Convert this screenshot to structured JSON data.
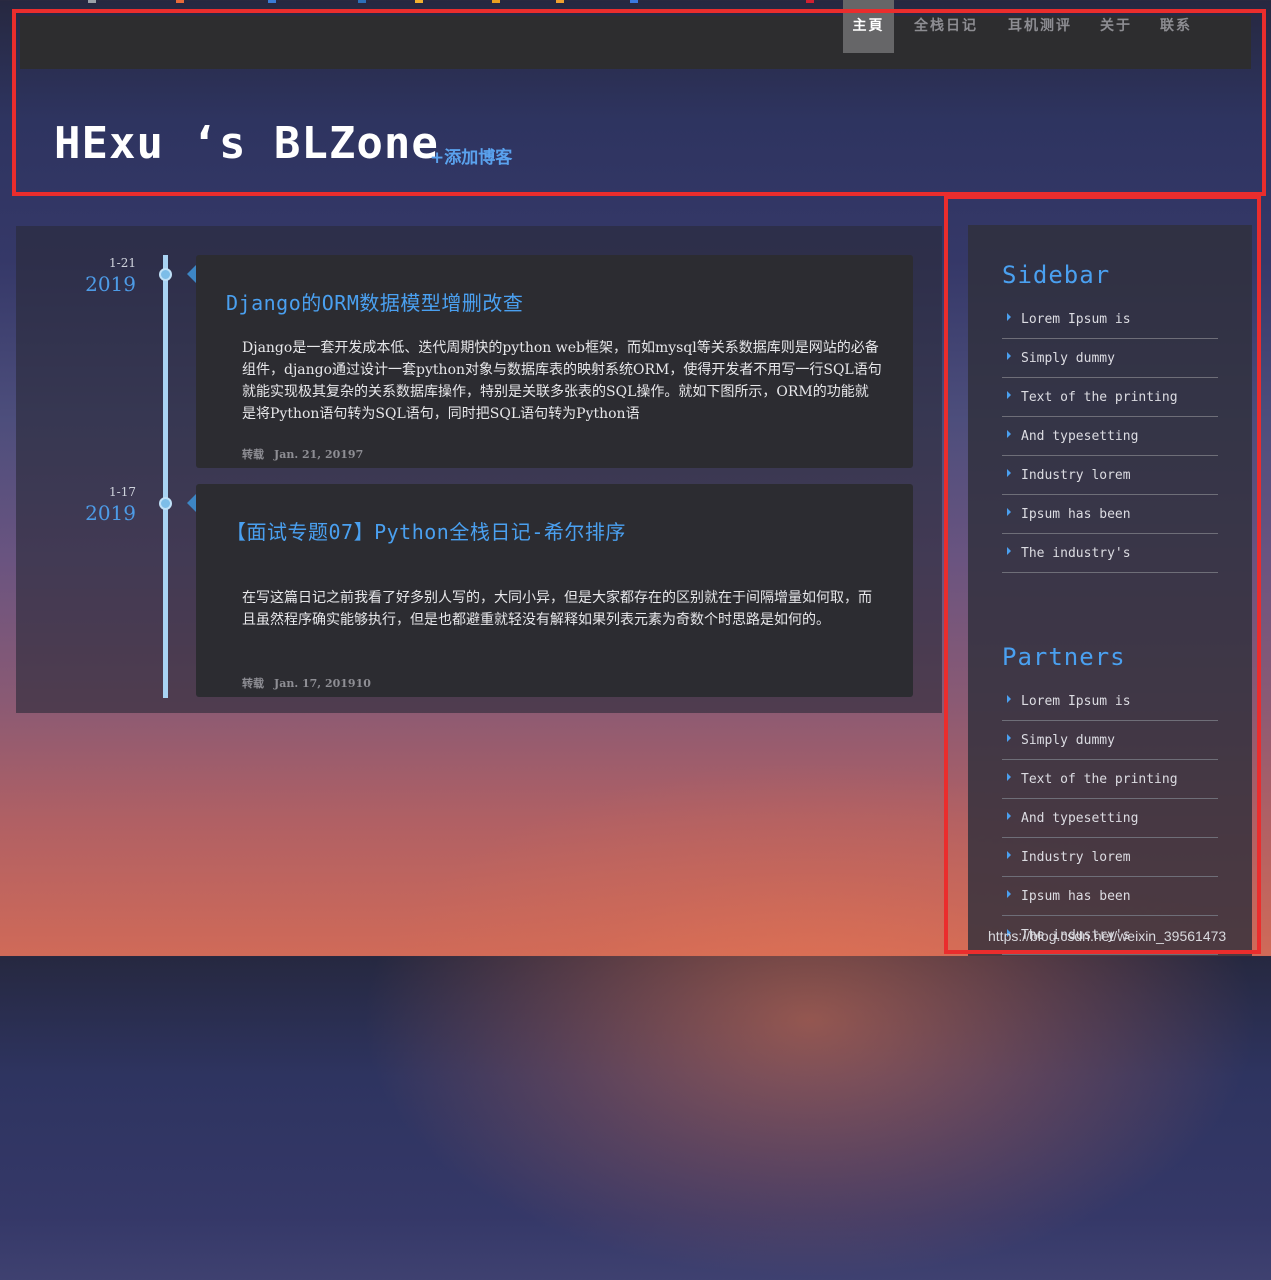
{
  "nav": {
    "items": [
      {
        "label": "主頁",
        "active": true
      },
      {
        "label": "全栈日记",
        "active": false
      },
      {
        "label": "耳机测评",
        "active": false
      },
      {
        "label": "关于",
        "active": false
      },
      {
        "label": "联系",
        "active": false
      }
    ]
  },
  "header": {
    "site_title": "HExu ‘s BLZone",
    "add_blog": "+添加博客"
  },
  "posts": [
    {
      "date_md": "1-21",
      "year": "2019",
      "title": "Django的ORM数据模型增删改查",
      "excerpt": "Django是一套开发成本低、迭代周期快的python web框架，而如mysql等关系数据库则是网站的必备组件，django通过设计一套python对象与数据库表的映射系统ORM，使得开发者不用写一行SQL语句就能实现极其复杂的关系数据库操作，特别是关联多张表的SQL操作。就如下图所示，ORM的功能就是将Python语句转为SQL语句，同时把SQL语句转为Python语",
      "tag": "转载",
      "meta": "Jan. 21, 20197"
    },
    {
      "date_md": "1-17",
      "year": "2019",
      "title": "【面试专题07】Python全栈日记-希尔排序",
      "excerpt": "在写这篇日记之前我看了好多别人写的，大同小异，但是大家都存在的区别就在于间隔增量如何取，而且虽然程序确实能够执行，但是也都避重就轻没有解释如果列表元素为奇数个时思路是如何的。",
      "tag": "转载",
      "meta": "Jan. 17, 201910"
    }
  ],
  "sidebar": {
    "heading": "Sidebar",
    "items": [
      "Lorem Ipsum is",
      "Simply dummy",
      "Text of the printing",
      "And typesetting",
      "Industry lorem",
      "Ipsum has been",
      "The industry's"
    ]
  },
  "partners": {
    "heading": "Partners",
    "items": [
      "Lorem Ipsum is",
      "Simply dummy",
      "Text of the printing",
      "And typesetting",
      "Industry lorem",
      "Ipsum has been",
      "The industry's"
    ]
  },
  "watermark": "https://blog.csdn.net/weixin_39561473",
  "colors": {
    "accent": "#4aa0f0",
    "highlight_border": "#ea2d2d",
    "navbar_bg": "#2d2d2f",
    "nav_active_bg": "#666668"
  }
}
